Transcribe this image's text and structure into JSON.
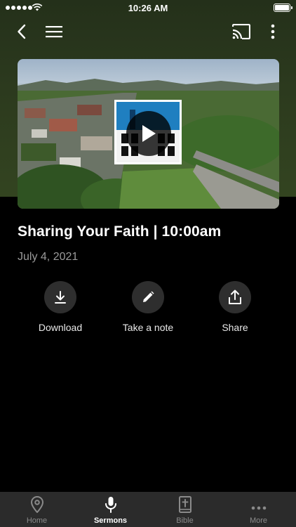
{
  "status_bar": {
    "time": "10:26 AM"
  },
  "sermon": {
    "title": "Sharing Your Faith | 10:00am",
    "date": "July 4, 2021"
  },
  "actions": [
    {
      "label": "Download",
      "icon": "download-icon"
    },
    {
      "label": "Take a note",
      "icon": "pencil-icon"
    },
    {
      "label": "Share",
      "icon": "share-icon"
    }
  ],
  "tabs": [
    {
      "label": "Home",
      "icon": "location-pin-icon",
      "active": false
    },
    {
      "label": "Sermons",
      "icon": "microphone-icon",
      "active": true
    },
    {
      "label": "Bible",
      "icon": "bible-icon",
      "active": false
    },
    {
      "label": "More",
      "icon": "more-dots-icon",
      "active": false
    }
  ],
  "colors": {
    "background": "#000000",
    "header_tint": "#2c3a1e",
    "tabbar": "#2b2b2b",
    "action_circle": "#2e2e2e"
  }
}
